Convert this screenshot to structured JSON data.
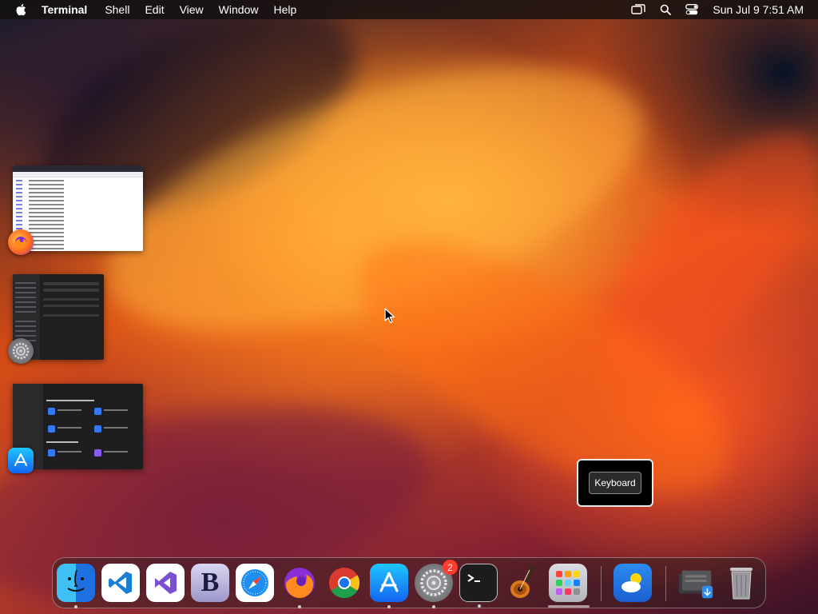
{
  "menubar": {
    "app_name": "Terminal",
    "menus": [
      "Shell",
      "Edit",
      "View",
      "Window",
      "Help"
    ],
    "clock": "Sun Jul 9  7:51 AM"
  },
  "hud": {
    "label": "Keyboard"
  },
  "dock": {
    "items": [
      "finder",
      "vscode",
      "visual-studio",
      "bbedit",
      "safari",
      "firefox",
      "chrome",
      "app-store",
      "system-settings",
      "terminal",
      "garageband",
      "launchpad",
      "weather",
      "downloads",
      "trash"
    ],
    "settings_badge": "2"
  },
  "colors": {
    "menubar_bg": "#141010",
    "hud_border": "#e8e8e8",
    "badge_red": "#ff3b30"
  }
}
